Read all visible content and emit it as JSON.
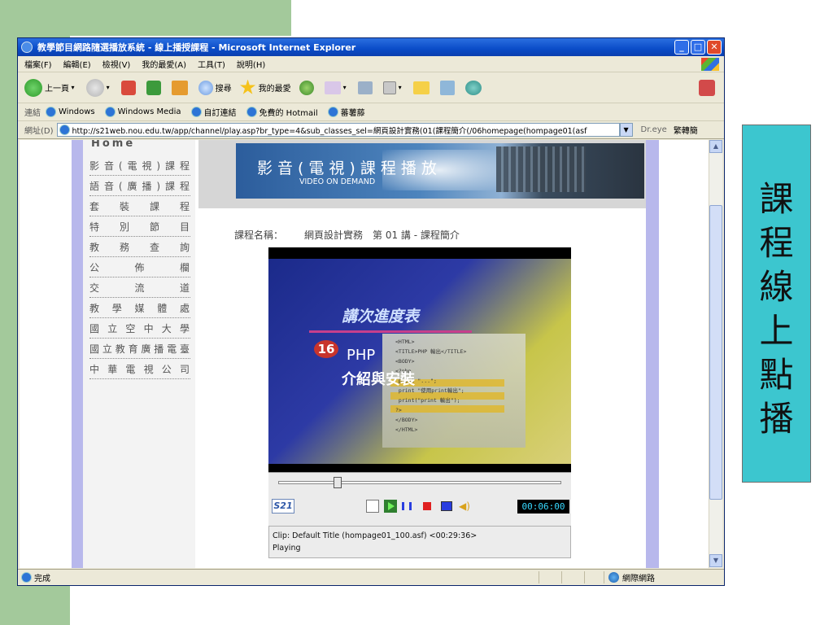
{
  "slide": {
    "side_label_chars": [
      "課",
      "程",
      "線",
      "上",
      "點",
      "播"
    ]
  },
  "window": {
    "title": "教學節目網路隨選播放系統 - 線上播授課程 - Microsoft Internet Explorer",
    "controls": {
      "minimize": "_",
      "maximize": "□",
      "close": "✕"
    }
  },
  "menubar": [
    "檔案(F)",
    "編輯(E)",
    "檢視(V)",
    "我的最愛(A)",
    "工具(T)",
    "說明(H)"
  ],
  "toolbar": {
    "back": "上一頁",
    "search": "搜尋",
    "favorites": "我的最愛"
  },
  "links": {
    "label": "連結",
    "items": [
      "Windows",
      "Windows Media",
      "自訂連結",
      "免費的 Hotmail",
      "蕃薯藤"
    ]
  },
  "address": {
    "label": "網址(D)",
    "url": "http://s21web.nou.edu.tw/app/channel/play.asp?br_type=4&sub_classes_sel=網頁設計實務(01(課程簡介(/06homepage(hompage01(asf",
    "extra1": "Dr.eye",
    "extra2": "繁轉簡"
  },
  "left_menu": {
    "home": "Home",
    "items": [
      "影音(電視)課程",
      "語音(廣播)課程",
      "套裝課程",
      "特別節目",
      "教務查詢",
      "公佈欄",
      "交流道",
      "教學媒體處",
      "國立空中大學",
      "國立教育廣播電臺",
      "中華電視公司"
    ]
  },
  "banner": {
    "title": "影音(電視)課程播放",
    "subtitle": "VIDEO ON DEMAND"
  },
  "course": {
    "label": "課程名稱：",
    "value": "網頁設計實務　第 01 講 - 課程簡介"
  },
  "video": {
    "title": "講次進度表",
    "number": "16",
    "line1": "PHP",
    "line2": "介紹與安裝",
    "code": "<HTML>\n<TITLE>PHP 輸出</TITLE>\n<BODY>\n<?php\n print \"...\";\n print \"使用print輸出\";\n print(\"print 輸出\");\n?>\n</BODY>\n</HTML>"
  },
  "player": {
    "logo": "S21",
    "timecode": "00:06:00",
    "progress": 0.21,
    "clip_line": "Clip: Default Title (hompage01_100.asf) <00:29:36>",
    "status_line": "Playing"
  },
  "statusbar": {
    "left": "完成",
    "zone": "網際網路"
  },
  "icons": {
    "ie": "internet-explorer-icon",
    "back": "back-arrow-icon",
    "forward": "forward-arrow-icon",
    "stop": "stop-icon",
    "refresh": "refresh-icon",
    "home": "home-icon",
    "search": "search-icon",
    "favorites": "star-icon",
    "media": "media-icon",
    "mail": "mail-icon",
    "print": "print-icon",
    "folder": "folder-icon",
    "globe": "globe-icon"
  }
}
